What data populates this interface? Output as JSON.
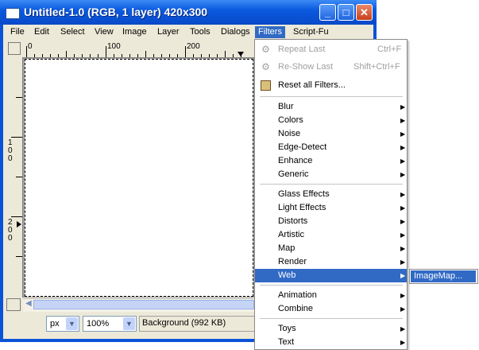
{
  "window": {
    "title": "Untitled-1.0 (RGB, 1 layer) 420x300",
    "controls": {
      "minimize": "_",
      "maximize": "□",
      "close": "✕"
    }
  },
  "menubar": {
    "items": [
      {
        "label": "File"
      },
      {
        "label": "Edit"
      },
      {
        "label": "Select"
      },
      {
        "label": "View"
      },
      {
        "label": "Image"
      },
      {
        "label": "Layer"
      },
      {
        "label": "Tools"
      },
      {
        "label": "Dialogs"
      },
      {
        "label": "Filters"
      },
      {
        "label": "Script-Fu"
      }
    ],
    "active": "Filters"
  },
  "ruler": {
    "h_labels": [
      "0",
      "100",
      "200"
    ],
    "v_labels": [
      "1",
      "0",
      "0",
      "2",
      "0",
      "0"
    ]
  },
  "statusbar": {
    "unit": "px",
    "zoom": "100%",
    "layer_info": "Background (992 KB)"
  },
  "filters_menu": {
    "repeat_last": {
      "label": "Repeat Last",
      "shortcut": "Ctrl+F",
      "disabled": true
    },
    "reshow_last": {
      "label": "Re-Show Last",
      "shortcut": "Shift+Ctrl+F",
      "disabled": true
    },
    "reset_all": {
      "label": "Reset all Filters..."
    },
    "group1": [
      "Blur",
      "Colors",
      "Noise",
      "Edge-Detect",
      "Enhance",
      "Generic"
    ],
    "group2": [
      "Glass Effects",
      "Light Effects",
      "Distorts",
      "Artistic",
      "Map",
      "Render",
      "Web"
    ],
    "group3": [
      "Animation",
      "Combine"
    ],
    "group4": [
      "Toys",
      "Text"
    ],
    "highlighted": "Web"
  },
  "web_submenu": {
    "items": [
      "ImageMap..."
    ]
  },
  "colors": {
    "titlebar": "#0a5ae0",
    "highlight": "#316ac5",
    "menu_bg": "#ffffff",
    "window_bg": "#ece9d8"
  }
}
